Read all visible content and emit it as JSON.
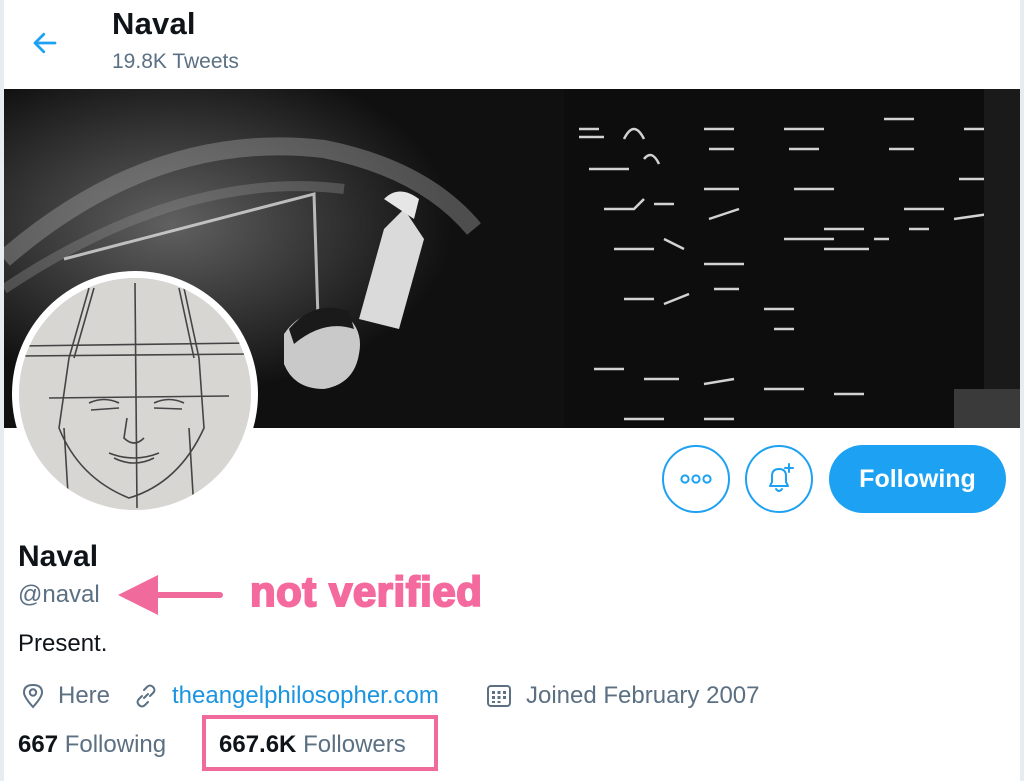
{
  "header": {
    "back_icon": "arrow-left-icon",
    "title": "Naval",
    "tweet_count": "19.8K Tweets"
  },
  "profile": {
    "name": "Naval",
    "handle": "@naval",
    "bio": "Present.",
    "location": "Here",
    "website": "theangelphilosopher.com",
    "joined": "Joined February 2007",
    "following_count": "667",
    "following_label": "Following",
    "followers_count": "667.6K",
    "followers_label": "Followers"
  },
  "actions": {
    "more_icon": "more-dots-icon",
    "notify_icon": "bell-plus-icon",
    "following_button": "Following"
  },
  "annotation": {
    "text": "not verified",
    "color": "#f46a9e"
  },
  "colors": {
    "accent": "#1da1f2",
    "link": "#1b95e0",
    "secondary_text": "#5b7083",
    "highlight_box": "#f06a9b"
  }
}
